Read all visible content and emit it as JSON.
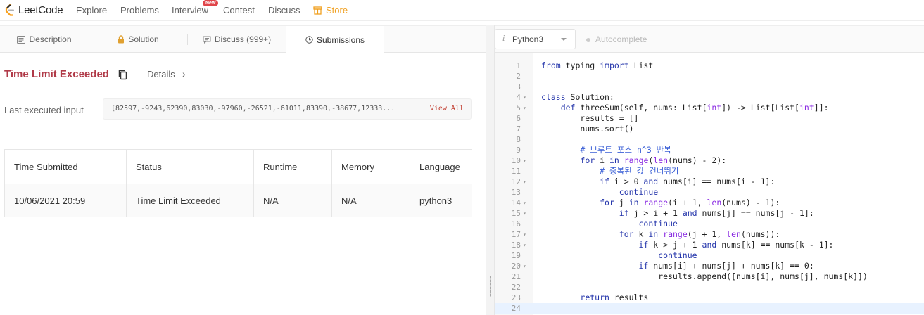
{
  "nav": {
    "logo_text": "LeetCode",
    "items": [
      "Explore",
      "Problems",
      "Interview",
      "Contest",
      "Discuss"
    ],
    "badge": "New",
    "store": "Store"
  },
  "tabs": {
    "description": "Description",
    "solution": "Solution",
    "discuss": "Discuss (999+)",
    "submissions": "Submissions"
  },
  "result": {
    "title": "Time Limit Exceeded",
    "details": "Details",
    "last_input_label": "Last executed input",
    "last_input_value": "[82597,-9243,62390,83030,-97960,-26521,-61011,83390,-38677,12333...",
    "view_all": "View All"
  },
  "submissions": {
    "headers": [
      "Time Submitted",
      "Status",
      "Runtime",
      "Memory",
      "Language"
    ],
    "rows": [
      [
        "10/06/2021 20:59",
        "Time Limit Exceeded",
        "N/A",
        "N/A",
        "python3"
      ]
    ]
  },
  "editor": {
    "language": "Python3",
    "autocomplete": "Autocomplete",
    "lines": [
      "from typing import List",
      "",
      "",
      "class Solution:",
      "    def threeSum(self, nums: List[int]) -> List[List[int]]:",
      "        results = []",
      "        nums.sort()",
      "",
      "        # 브루트 포스 n^3 반복",
      "        for i in range(len(nums) - 2):",
      "            # 중복된 값 건너뛰기",
      "            if i > 0 and nums[i] == nums[i - 1]:",
      "                continue",
      "            for j in range(i + 1, len(nums) - 1):",
      "                if j > i + 1 and nums[j] == nums[j - 1]:",
      "                    continue",
      "                for k in range(j + 1, len(nums)):",
      "                    if k > j + 1 and nums[k] == nums[k - 1]:",
      "                        continue",
      "                    if nums[i] + nums[j] + nums[k] == 0:",
      "                        results.append([nums[i], nums[j], nums[k]])",
      "",
      "        return results",
      ""
    ],
    "fold_lines": [
      4,
      5,
      10,
      12,
      14,
      15,
      17,
      18,
      20
    ],
    "active_line": 24
  }
}
